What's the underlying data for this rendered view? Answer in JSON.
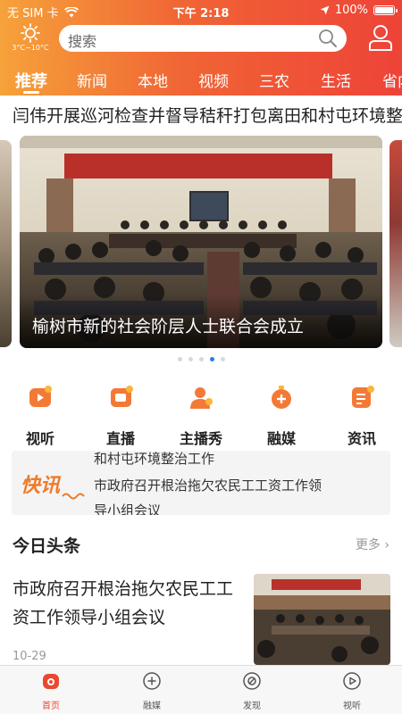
{
  "status_bar": {
    "carrier": "无 SIM 卡",
    "time": "下午 2:18",
    "battery": "100%"
  },
  "header": {
    "weather_temp": "3°C~10°C",
    "weather_icon": "sun-icon",
    "search_placeholder": "搜索",
    "tabs": [
      "推荐",
      "新闻",
      "本地",
      "视频",
      "三农",
      "生活",
      "省内"
    ],
    "active_tab": "推荐"
  },
  "ticker": {
    "text": "闫伟开展巡河检查并督导秸秆打包离田和村屯环境整治工作"
  },
  "carousel": {
    "caption": "榆树市新的社会阶层人士联合会成立",
    "banner_text": "榆树市新的社会阶层人士联合会成立大会",
    "dot_count": 5,
    "active_dot": 3
  },
  "quick_links": [
    {
      "label": "视听",
      "icon": "play-icon"
    },
    {
      "label": "直播",
      "icon": "live-icon"
    },
    {
      "label": "主播秀",
      "icon": "anchor-icon"
    },
    {
      "label": "融媒",
      "icon": "media-plus-icon"
    },
    {
      "label": "资讯",
      "icon": "info-doc-icon"
    }
  ],
  "flash": {
    "logo": "快讯",
    "lines": [
      "和村屯环境整治工作",
      "市政府召开根治拖欠农民工工资工作领",
      "导小组会议"
    ]
  },
  "headlines": {
    "title": "今日头条",
    "more": "更多 ›",
    "item": {
      "title": "市政府召开根治拖欠农民工工资工作领导小组会议",
      "date": "10-29"
    }
  },
  "bottom_nav": [
    {
      "label": "首页",
      "active": true
    },
    {
      "label": "融媒",
      "active": false
    },
    {
      "label": "发现",
      "active": false
    },
    {
      "label": "视听",
      "active": false
    }
  ],
  "colors": {
    "header_start": "#f6a23a",
    "header_end": "#ee4338",
    "accent": "#e94a2f",
    "dot_active": "#2a7be4"
  }
}
